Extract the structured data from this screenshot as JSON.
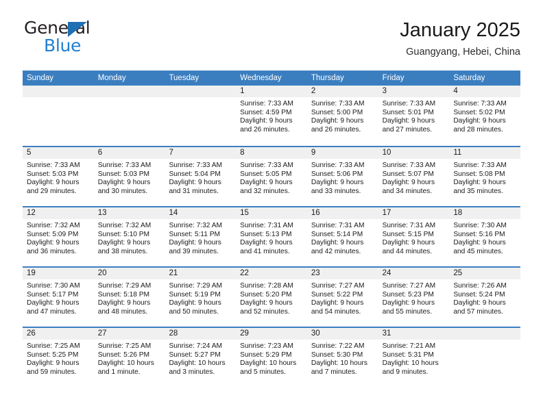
{
  "brand": {
    "name_top": "General",
    "name_bottom": "Blue",
    "triangle_color": "#1f6fb4",
    "blue_text_color": "#1f7fd0"
  },
  "header": {
    "title": "January 2025",
    "subtitle": "Guangyang, Hebei, China"
  },
  "theme": {
    "header_blue": "#3b7ec0",
    "day_band_gray": "#f0f0f0",
    "text_color": "#1a1a1a"
  },
  "weekdays": [
    "Sunday",
    "Monday",
    "Tuesday",
    "Wednesday",
    "Thursday",
    "Friday",
    "Saturday"
  ],
  "weeks": [
    [
      {
        "date": "",
        "sunrise": "",
        "sunset": "",
        "daylight_a": "",
        "daylight_b": ""
      },
      {
        "date": "",
        "sunrise": "",
        "sunset": "",
        "daylight_a": "",
        "daylight_b": ""
      },
      {
        "date": "",
        "sunrise": "",
        "sunset": "",
        "daylight_a": "",
        "daylight_b": ""
      },
      {
        "date": "1",
        "sunrise": "Sunrise: 7:33 AM",
        "sunset": "Sunset: 4:59 PM",
        "daylight_a": "Daylight: 9 hours",
        "daylight_b": "and 26 minutes."
      },
      {
        "date": "2",
        "sunrise": "Sunrise: 7:33 AM",
        "sunset": "Sunset: 5:00 PM",
        "daylight_a": "Daylight: 9 hours",
        "daylight_b": "and 26 minutes."
      },
      {
        "date": "3",
        "sunrise": "Sunrise: 7:33 AM",
        "sunset": "Sunset: 5:01 PM",
        "daylight_a": "Daylight: 9 hours",
        "daylight_b": "and 27 minutes."
      },
      {
        "date": "4",
        "sunrise": "Sunrise: 7:33 AM",
        "sunset": "Sunset: 5:02 PM",
        "daylight_a": "Daylight: 9 hours",
        "daylight_b": "and 28 minutes."
      }
    ],
    [
      {
        "date": "5",
        "sunrise": "Sunrise: 7:33 AM",
        "sunset": "Sunset: 5:03 PM",
        "daylight_a": "Daylight: 9 hours",
        "daylight_b": "and 29 minutes."
      },
      {
        "date": "6",
        "sunrise": "Sunrise: 7:33 AM",
        "sunset": "Sunset: 5:03 PM",
        "daylight_a": "Daylight: 9 hours",
        "daylight_b": "and 30 minutes."
      },
      {
        "date": "7",
        "sunrise": "Sunrise: 7:33 AM",
        "sunset": "Sunset: 5:04 PM",
        "daylight_a": "Daylight: 9 hours",
        "daylight_b": "and 31 minutes."
      },
      {
        "date": "8",
        "sunrise": "Sunrise: 7:33 AM",
        "sunset": "Sunset: 5:05 PM",
        "daylight_a": "Daylight: 9 hours",
        "daylight_b": "and 32 minutes."
      },
      {
        "date": "9",
        "sunrise": "Sunrise: 7:33 AM",
        "sunset": "Sunset: 5:06 PM",
        "daylight_a": "Daylight: 9 hours",
        "daylight_b": "and 33 minutes."
      },
      {
        "date": "10",
        "sunrise": "Sunrise: 7:33 AM",
        "sunset": "Sunset: 5:07 PM",
        "daylight_a": "Daylight: 9 hours",
        "daylight_b": "and 34 minutes."
      },
      {
        "date": "11",
        "sunrise": "Sunrise: 7:33 AM",
        "sunset": "Sunset: 5:08 PM",
        "daylight_a": "Daylight: 9 hours",
        "daylight_b": "and 35 minutes."
      }
    ],
    [
      {
        "date": "12",
        "sunrise": "Sunrise: 7:32 AM",
        "sunset": "Sunset: 5:09 PM",
        "daylight_a": "Daylight: 9 hours",
        "daylight_b": "and 36 minutes."
      },
      {
        "date": "13",
        "sunrise": "Sunrise: 7:32 AM",
        "sunset": "Sunset: 5:10 PM",
        "daylight_a": "Daylight: 9 hours",
        "daylight_b": "and 38 minutes."
      },
      {
        "date": "14",
        "sunrise": "Sunrise: 7:32 AM",
        "sunset": "Sunset: 5:11 PM",
        "daylight_a": "Daylight: 9 hours",
        "daylight_b": "and 39 minutes."
      },
      {
        "date": "15",
        "sunrise": "Sunrise: 7:31 AM",
        "sunset": "Sunset: 5:13 PM",
        "daylight_a": "Daylight: 9 hours",
        "daylight_b": "and 41 minutes."
      },
      {
        "date": "16",
        "sunrise": "Sunrise: 7:31 AM",
        "sunset": "Sunset: 5:14 PM",
        "daylight_a": "Daylight: 9 hours",
        "daylight_b": "and 42 minutes."
      },
      {
        "date": "17",
        "sunrise": "Sunrise: 7:31 AM",
        "sunset": "Sunset: 5:15 PM",
        "daylight_a": "Daylight: 9 hours",
        "daylight_b": "and 44 minutes."
      },
      {
        "date": "18",
        "sunrise": "Sunrise: 7:30 AM",
        "sunset": "Sunset: 5:16 PM",
        "daylight_a": "Daylight: 9 hours",
        "daylight_b": "and 45 minutes."
      }
    ],
    [
      {
        "date": "19",
        "sunrise": "Sunrise: 7:30 AM",
        "sunset": "Sunset: 5:17 PM",
        "daylight_a": "Daylight: 9 hours",
        "daylight_b": "and 47 minutes."
      },
      {
        "date": "20",
        "sunrise": "Sunrise: 7:29 AM",
        "sunset": "Sunset: 5:18 PM",
        "daylight_a": "Daylight: 9 hours",
        "daylight_b": "and 48 minutes."
      },
      {
        "date": "21",
        "sunrise": "Sunrise: 7:29 AM",
        "sunset": "Sunset: 5:19 PM",
        "daylight_a": "Daylight: 9 hours",
        "daylight_b": "and 50 minutes."
      },
      {
        "date": "22",
        "sunrise": "Sunrise: 7:28 AM",
        "sunset": "Sunset: 5:20 PM",
        "daylight_a": "Daylight: 9 hours",
        "daylight_b": "and 52 minutes."
      },
      {
        "date": "23",
        "sunrise": "Sunrise: 7:27 AM",
        "sunset": "Sunset: 5:22 PM",
        "daylight_a": "Daylight: 9 hours",
        "daylight_b": "and 54 minutes."
      },
      {
        "date": "24",
        "sunrise": "Sunrise: 7:27 AM",
        "sunset": "Sunset: 5:23 PM",
        "daylight_a": "Daylight: 9 hours",
        "daylight_b": "and 55 minutes."
      },
      {
        "date": "25",
        "sunrise": "Sunrise: 7:26 AM",
        "sunset": "Sunset: 5:24 PM",
        "daylight_a": "Daylight: 9 hours",
        "daylight_b": "and 57 minutes."
      }
    ],
    [
      {
        "date": "26",
        "sunrise": "Sunrise: 7:25 AM",
        "sunset": "Sunset: 5:25 PM",
        "daylight_a": "Daylight: 9 hours",
        "daylight_b": "and 59 minutes."
      },
      {
        "date": "27",
        "sunrise": "Sunrise: 7:25 AM",
        "sunset": "Sunset: 5:26 PM",
        "daylight_a": "Daylight: 10 hours",
        "daylight_b": "and 1 minute."
      },
      {
        "date": "28",
        "sunrise": "Sunrise: 7:24 AM",
        "sunset": "Sunset: 5:27 PM",
        "daylight_a": "Daylight: 10 hours",
        "daylight_b": "and 3 minutes."
      },
      {
        "date": "29",
        "sunrise": "Sunrise: 7:23 AM",
        "sunset": "Sunset: 5:29 PM",
        "daylight_a": "Daylight: 10 hours",
        "daylight_b": "and 5 minutes."
      },
      {
        "date": "30",
        "sunrise": "Sunrise: 7:22 AM",
        "sunset": "Sunset: 5:30 PM",
        "daylight_a": "Daylight: 10 hours",
        "daylight_b": "and 7 minutes."
      },
      {
        "date": "31",
        "sunrise": "Sunrise: 7:21 AM",
        "sunset": "Sunset: 5:31 PM",
        "daylight_a": "Daylight: 10 hours",
        "daylight_b": "and 9 minutes."
      },
      {
        "date": "",
        "sunrise": "",
        "sunset": "",
        "daylight_a": "",
        "daylight_b": ""
      }
    ]
  ]
}
